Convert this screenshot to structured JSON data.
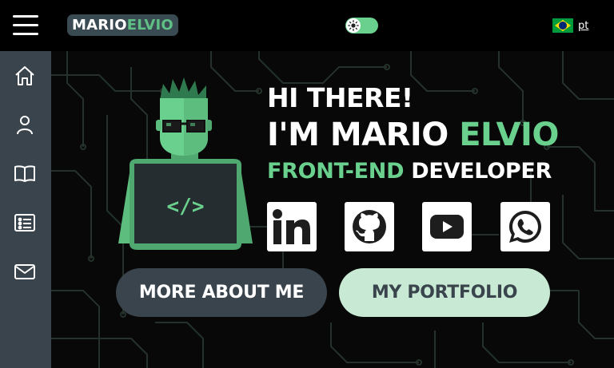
{
  "header": {
    "menu_icon": "hamburger-icon",
    "logo": {
      "part1": "MARIO",
      "part2": "ELVIO"
    },
    "theme_toggle": {
      "icon": "sun-icon",
      "state": "dark"
    },
    "language": {
      "flag": "brazil-flag",
      "label": "pt"
    }
  },
  "sidebar": {
    "items": [
      {
        "icon": "home-icon"
      },
      {
        "icon": "user-icon"
      },
      {
        "icon": "book-icon"
      },
      {
        "icon": "resume-icon"
      },
      {
        "icon": "mail-icon"
      }
    ]
  },
  "hero": {
    "line1": "HI THERE!",
    "line2_a": "I'M MARIO ",
    "line2_b": "ELVIO",
    "line3_a": "FRONT-END ",
    "line3_b": "DEVELOPER",
    "laptop_code": "</>"
  },
  "social": [
    {
      "icon": "linkedin-icon"
    },
    {
      "icon": "github-icon"
    },
    {
      "icon": "youtube-icon"
    },
    {
      "icon": "whatsapp-icon"
    }
  ],
  "buttons": {
    "about": "MORE ABOUT ME",
    "portfolio": "MY PORTFOLIO"
  },
  "colors": {
    "accent": "#6ad08e",
    "sidebar": "#3a444c",
    "background": "#000000"
  }
}
